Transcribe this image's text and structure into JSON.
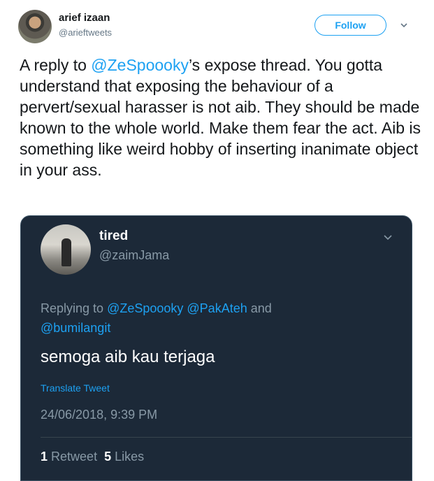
{
  "tweet": {
    "author_name": "arief izaan",
    "author_handle": "@arieftweets",
    "follow_label": "Follow",
    "text_prefix": "A reply to ",
    "mention": "@ZeSpoooky",
    "text_rest": "’s expose thread. You gotta understand that exposing the behaviour of a pervert/sexual harasser is not aib. They should be made known to the whole world. Make them fear the act. Aib is something like weird hobby of inserting inanimate object in your ass."
  },
  "quoted": {
    "name": "tired",
    "handle": "@zaimJama",
    "replying_prefix": "Replying to ",
    "replying_mentions": [
      "@ZeSpoooky",
      "@PakAteh",
      "@bumilangit"
    ],
    "replying_and": " and ",
    "text": "semoga aib kau terjaga",
    "translate_label": "Translate Tweet",
    "timestamp": "24/06/2018, 9:39 PM",
    "retweet_count": "1",
    "retweet_label": "Retweet",
    "likes_count": "5",
    "likes_label": "Likes"
  },
  "colors": {
    "accent": "#1da1f2",
    "card_bg": "#1c2938",
    "muted": "#8899a6"
  }
}
